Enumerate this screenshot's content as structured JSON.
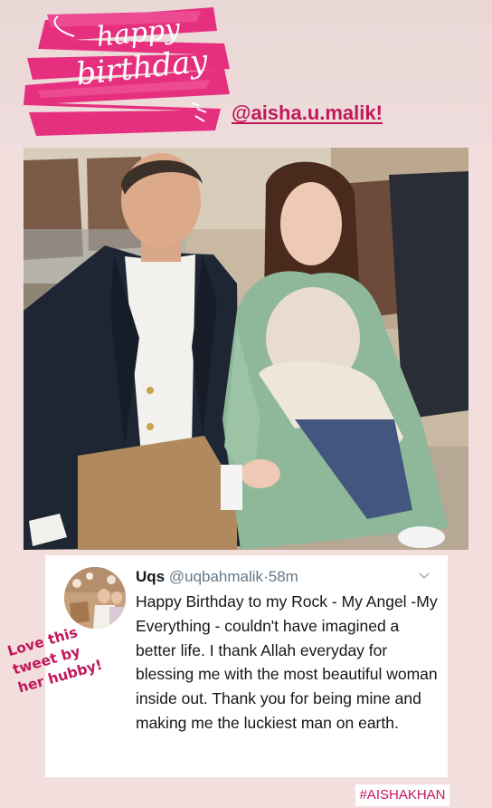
{
  "story": {
    "sticker": {
      "line1": "happy",
      "line2": "birthday",
      "color": "#e6307f"
    },
    "mention": "@aisha.u.malik!",
    "photo_alt": "photo",
    "annotation": {
      "lines": [
        "Love this",
        "tweet by",
        "her hubby!"
      ]
    },
    "hashtag": "#AISHAKHAN"
  },
  "tweet": {
    "name": "Uqs",
    "handle": "@uqbahmalik",
    "separator": "·",
    "time": "58m",
    "text": "Happy Birthday to my Rock - My Angel -My Everything - couldn't have imagined a better life. I thank Allah everyday for blessing me with the most beautiful woman inside out. Thank you for being mine and making me the luckiest man on earth."
  },
  "colors": {
    "accent": "#c2185b",
    "background": "#f3dede",
    "card": "#ffffff"
  }
}
